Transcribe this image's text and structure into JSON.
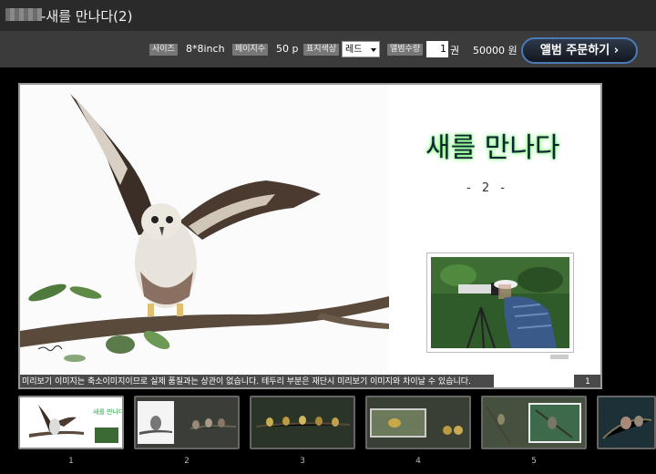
{
  "window": {
    "title": "-새를 만나다(2)"
  },
  "toolbar": {
    "size_label": "사이즈",
    "size_value": "8*8inch",
    "pages_label": "페이지수",
    "pages_value": "50 p",
    "cover_color_label": "표지색상",
    "cover_color_value": "레드",
    "album_qty_label": "앨범수량",
    "album_qty_value": "1",
    "qty_unit": "권",
    "price": "50000 원",
    "order_button_label": "앨범 주문하기 ›"
  },
  "page": {
    "book_title": "새를 만나다",
    "book_subtitle": "- 2 -",
    "notice": "미리보기 이미지는 축소이미지이므로 실제 품질과는 상관이 없습니다. 테두리 부분은 재단시 미리보기 이미지와 차이날 수 있습니다.",
    "page_number": "1"
  },
  "thumbnails": [
    {
      "number": "1"
    },
    {
      "number": "2"
    },
    {
      "number": "3"
    },
    {
      "number": "4"
    },
    {
      "number": "5"
    },
    {
      "number": ""
    }
  ],
  "colors": {
    "toolbar_bg": "#3b3b3b",
    "order_button_border": "#4a7bb8",
    "title_glow": "#66ff66"
  }
}
